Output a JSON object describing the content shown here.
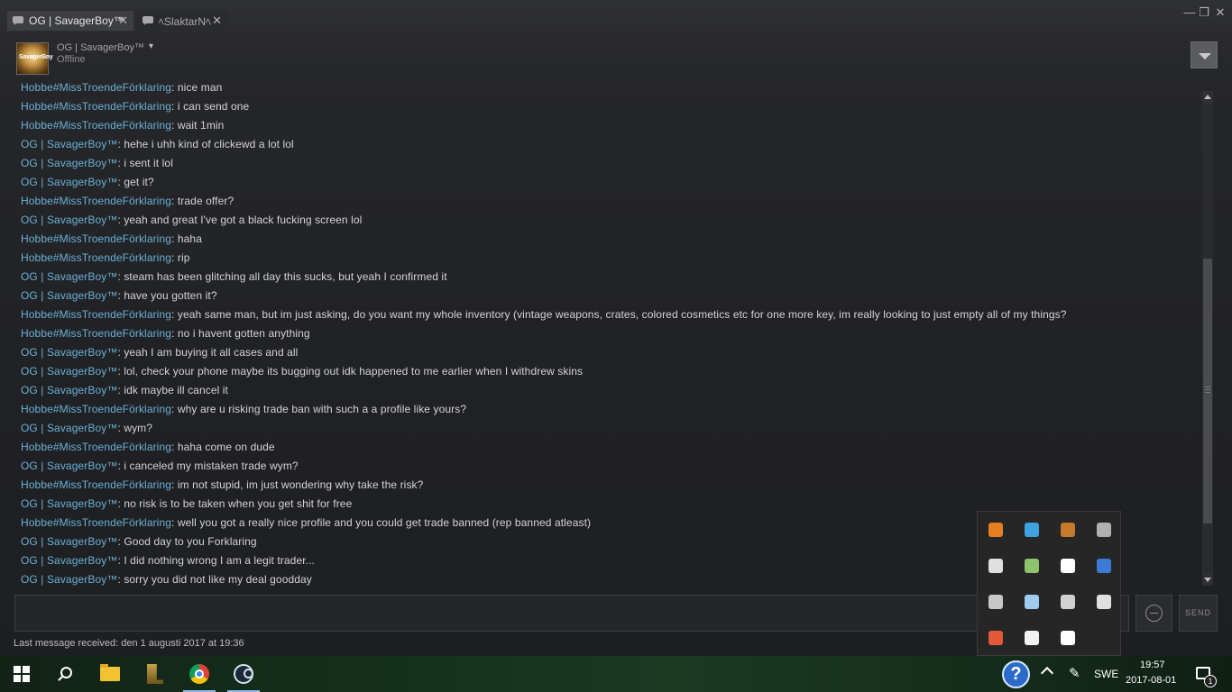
{
  "tabs": [
    {
      "label": "OG | SavagerBoy™",
      "close": "✕"
    },
    {
      "label": "ﾍSlaktarNﾍ",
      "close": "✕"
    }
  ],
  "window_controls": {
    "minimize": "—",
    "restore": "❐",
    "close": "✕"
  },
  "friend": {
    "name": "OG | SavagerBoy™",
    "status": "Offline",
    "avatar_text": "SavagerBoy",
    "caret": "▾"
  },
  "messages": [
    {
      "who": "Hobbe#MissTroendeFörklaring",
      "text": "nice man"
    },
    {
      "who": "Hobbe#MissTroendeFörklaring",
      "text": "i can send one"
    },
    {
      "who": "Hobbe#MissTroendeFörklaring",
      "text": "wait 1min"
    },
    {
      "who": "OG | SavagerBoy™",
      "text": "hehe i uhh kind of clickewd a lot lol"
    },
    {
      "who": "OG | SavagerBoy™",
      "text": "i sent it lol"
    },
    {
      "who": "OG | SavagerBoy™",
      "text": "get it?"
    },
    {
      "who": "Hobbe#MissTroendeFörklaring",
      "text": "trade offer?"
    },
    {
      "who": "OG | SavagerBoy™",
      "text": "yeah and great I've got a black fucking screen lol"
    },
    {
      "who": "Hobbe#MissTroendeFörklaring",
      "text": "haha"
    },
    {
      "who": "Hobbe#MissTroendeFörklaring",
      "text": "rip"
    },
    {
      "who": "OG | SavagerBoy™",
      "text": "steam has been glitching all day this sucks, but yeah I confirmed it"
    },
    {
      "who": "OG | SavagerBoy™",
      "text": "have you gotten it?"
    },
    {
      "who": "Hobbe#MissTroendeFörklaring",
      "text": "yeah same man, but im just asking, do you want my whole inventory (vintage weapons, crates, colored cosmetics etc for one more key, im really looking to just empty all of my things?"
    },
    {
      "who": "Hobbe#MissTroendeFörklaring",
      "text": "no i havent gotten anything"
    },
    {
      "who": "OG | SavagerBoy™",
      "text": "yeah I am buying it all cases and all"
    },
    {
      "who": "OG | SavagerBoy™",
      "text": "lol, check your phone maybe its bugging out idk happened to me earlier when I withdrew skins"
    },
    {
      "who": "OG | SavagerBoy™",
      "text": "idk maybe ill cancel it"
    },
    {
      "who": "Hobbe#MissTroendeFörklaring",
      "text": "why are u risking trade ban with such a a profile like yours?"
    },
    {
      "who": "OG | SavagerBoy™",
      "text": "wym?"
    },
    {
      "who": "Hobbe#MissTroendeFörklaring",
      "text": "haha come on dude"
    },
    {
      "who": "OG | SavagerBoy™",
      "text": "i canceled my mistaken trade wym?"
    },
    {
      "who": "Hobbe#MissTroendeFörklaring",
      "text": "im not stupid, im just wondering why take the risk?"
    },
    {
      "who": "OG | SavagerBoy™",
      "text": "no risk is to be taken when you get shit for free"
    },
    {
      "who": "Hobbe#MissTroendeFörklaring",
      "text": "well you got a really nice profile and you could get trade banned (rep banned atleast)"
    },
    {
      "who": "OG | SavagerBoy™",
      "text": "Good day to you Forklaring"
    },
    {
      "who": "OG | SavagerBoy™",
      "text": "I did nothing wrong I am a legit trader..."
    },
    {
      "who": "OG | SavagerBoy™",
      "text": "sorry you did not like my deal goodday"
    }
  ],
  "composer": {
    "send_label": "SEND"
  },
  "last_message": "Last message received: den 1 augusti 2017 at 19:36",
  "tray_popup_icons": [
    {
      "name": "java-update-icon",
      "color": "#e67e22"
    },
    {
      "name": "shield-check-icon",
      "color": "#3fa2e0"
    },
    {
      "name": "drive-orb-icon",
      "color": "#c67b2a"
    },
    {
      "name": "display-icon",
      "color": "#b0b0b0"
    },
    {
      "name": "battery-icon",
      "color": "#e0e0e0"
    },
    {
      "name": "network-check-icon",
      "color": "#8ec26b"
    },
    {
      "name": "volume-icon",
      "color": "#ffffff"
    },
    {
      "name": "bluetooth-icon",
      "color": "#3b7bd6"
    },
    {
      "name": "onedrive-icon",
      "color": "#c8c8c8"
    },
    {
      "name": "steam-tray-icon",
      "color": "#9ecbee"
    },
    {
      "name": "share-icon",
      "color": "#d0d0d0"
    },
    {
      "name": "wifi-icon",
      "color": "#e0e0e0"
    },
    {
      "name": "chrome-tray-icon",
      "color": "#e25a3a"
    },
    {
      "name": "defender-icon",
      "color": "#f2f2f2"
    },
    {
      "name": "discord-icon",
      "color": "#ffffff"
    }
  ],
  "taskbar": {
    "language": "SWE",
    "time": "19:57",
    "date": "2017-08-01",
    "notification_count": "1",
    "help_glyph": "?",
    "pen_glyph": "✎"
  }
}
